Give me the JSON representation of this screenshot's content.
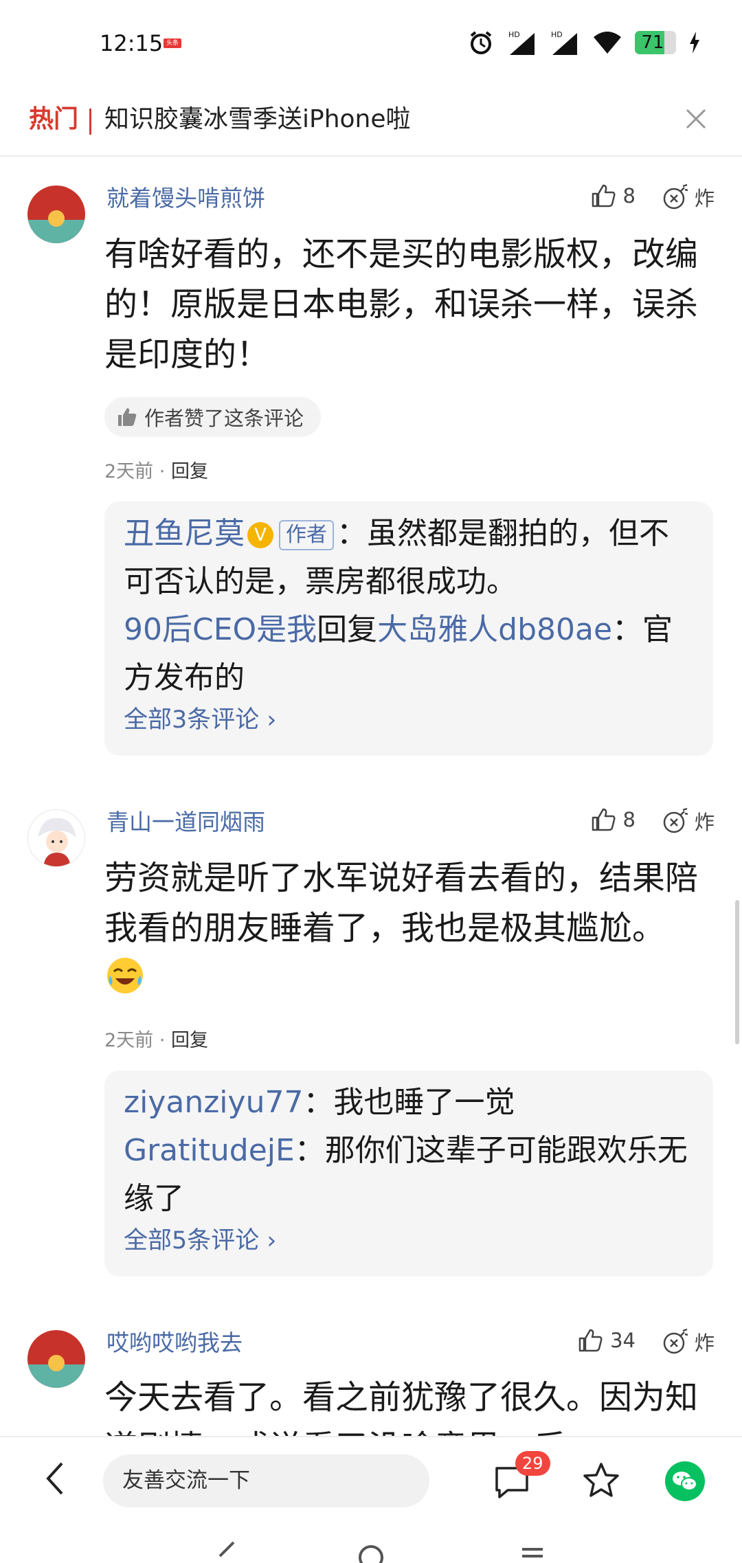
{
  "status_bar": {
    "time": "12:15",
    "news_badge": "头条",
    "battery": "71",
    "battery_level": 0.71
  },
  "hot_bar": {
    "label": "热门",
    "title": "知识胶囊冰雪季送iPhone啦"
  },
  "comments": [
    {
      "username": "就着馒头啃煎饼",
      "likes": "8",
      "bomb_label": "炸",
      "text": "有啥好看的，还不是买的电影版权，改编的！原版是日本电影，和误杀一样，误杀是印度的！",
      "author_liked": "作者赞了这条评论",
      "time": "2天前",
      "dot": "·",
      "reply_label": "回复",
      "replies": {
        "r1_name": "丑鱼尼莫",
        "r1_vbadge": "V",
        "r1_author_tag": "作者",
        "r1_text": "：虽然都是翻拍的，但不可否认的是，票房都很成功。",
        "r2_name": "90后CEO是我",
        "r2_mid": "回复",
        "r2_target": "大岛雅人db80ae",
        "r2_text": "：官方发布的",
        "more": "全部3条评论 ›"
      }
    },
    {
      "username": "青山一道同烟雨",
      "likes": "8",
      "bomb_label": "炸",
      "text": "劳资就是听了水军说好看去看的，结果陪我看的朋友睡着了，我也是极其尴尬。",
      "time": "2天前",
      "dot": "·",
      "reply_label": "回复",
      "replies": {
        "r1_name": "ziyanziyu77",
        "r1_text": "：我也睡了一觉",
        "r2_name": "GratitudejE",
        "r2_text": "：那你们这辈子可能跟欢乐无缘了",
        "more": "全部5条评论 ›"
      }
    },
    {
      "username": "哎哟哎哟我去",
      "likes": "34",
      "bomb_label": "炸",
      "text": "今天去看了。看之前犹豫了很久。因为知道剧情，或说看了没啥意思，后"
    }
  ],
  "bottom_bar": {
    "input_placeholder": "友善交流一下",
    "comment_count": "29"
  },
  "colors": {
    "hot": "#d83a2f",
    "link": "#4a6aa5",
    "wechat": "#07c160",
    "badge": "#f2453d"
  }
}
